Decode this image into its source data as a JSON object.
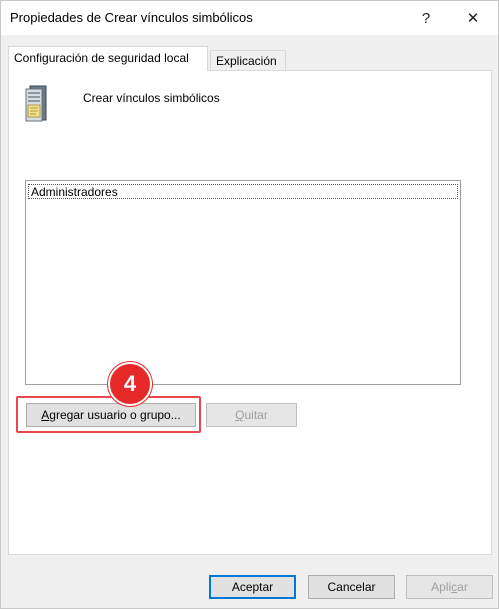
{
  "window": {
    "title": "Propiedades de Crear vínculos simbólicos",
    "help_glyph": "?",
    "close_glyph": "✕"
  },
  "tabs": [
    {
      "label": "Configuración de seguridad local",
      "active": true
    },
    {
      "label": "Explicación",
      "active": false
    }
  ],
  "policy": {
    "icon": "server-policy-icon",
    "name": "Crear vínculos simbólicos"
  },
  "list": {
    "items": [
      "Administradores"
    ]
  },
  "buttons": {
    "add_prefix": "A",
    "add_rest": "gregar usuario o grupo...",
    "remove_prefix": "Q",
    "remove_rest": "uitar",
    "ok": "Aceptar",
    "cancel": "Cancelar",
    "apply_prefix": "Apli",
    "apply_underline": "c",
    "apply_rest": "ar"
  },
  "annotation": {
    "step": "4",
    "color": "#e62a2a"
  }
}
